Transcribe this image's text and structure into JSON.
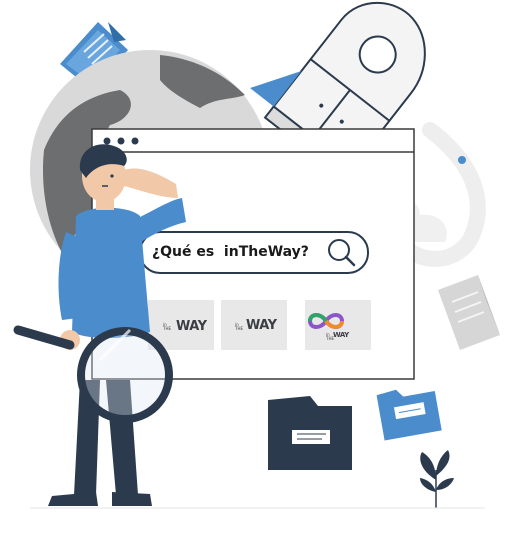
{
  "search": {
    "query": "¿Qué es  inTheWay?"
  },
  "results": [
    {
      "small_top": "in",
      "small_bottom": "THE",
      "word": "WAY"
    },
    {
      "small_top": "in",
      "small_bottom": "THE",
      "word": "WAY"
    },
    {
      "small_top": "in",
      "small_bottom": "THE",
      "word": "WAY"
    }
  ],
  "colors": {
    "accent_blue": "#4a8ccc",
    "dark_navy": "#2b3b4d",
    "globe_gray": "#6d6e70",
    "light_gray": "#e3e3e3"
  },
  "icons": [
    "document-icon",
    "globe-icon",
    "rocket-icon",
    "search-icon",
    "folder-icon",
    "plant-icon",
    "magnifier-icon",
    "person-illustration"
  ]
}
